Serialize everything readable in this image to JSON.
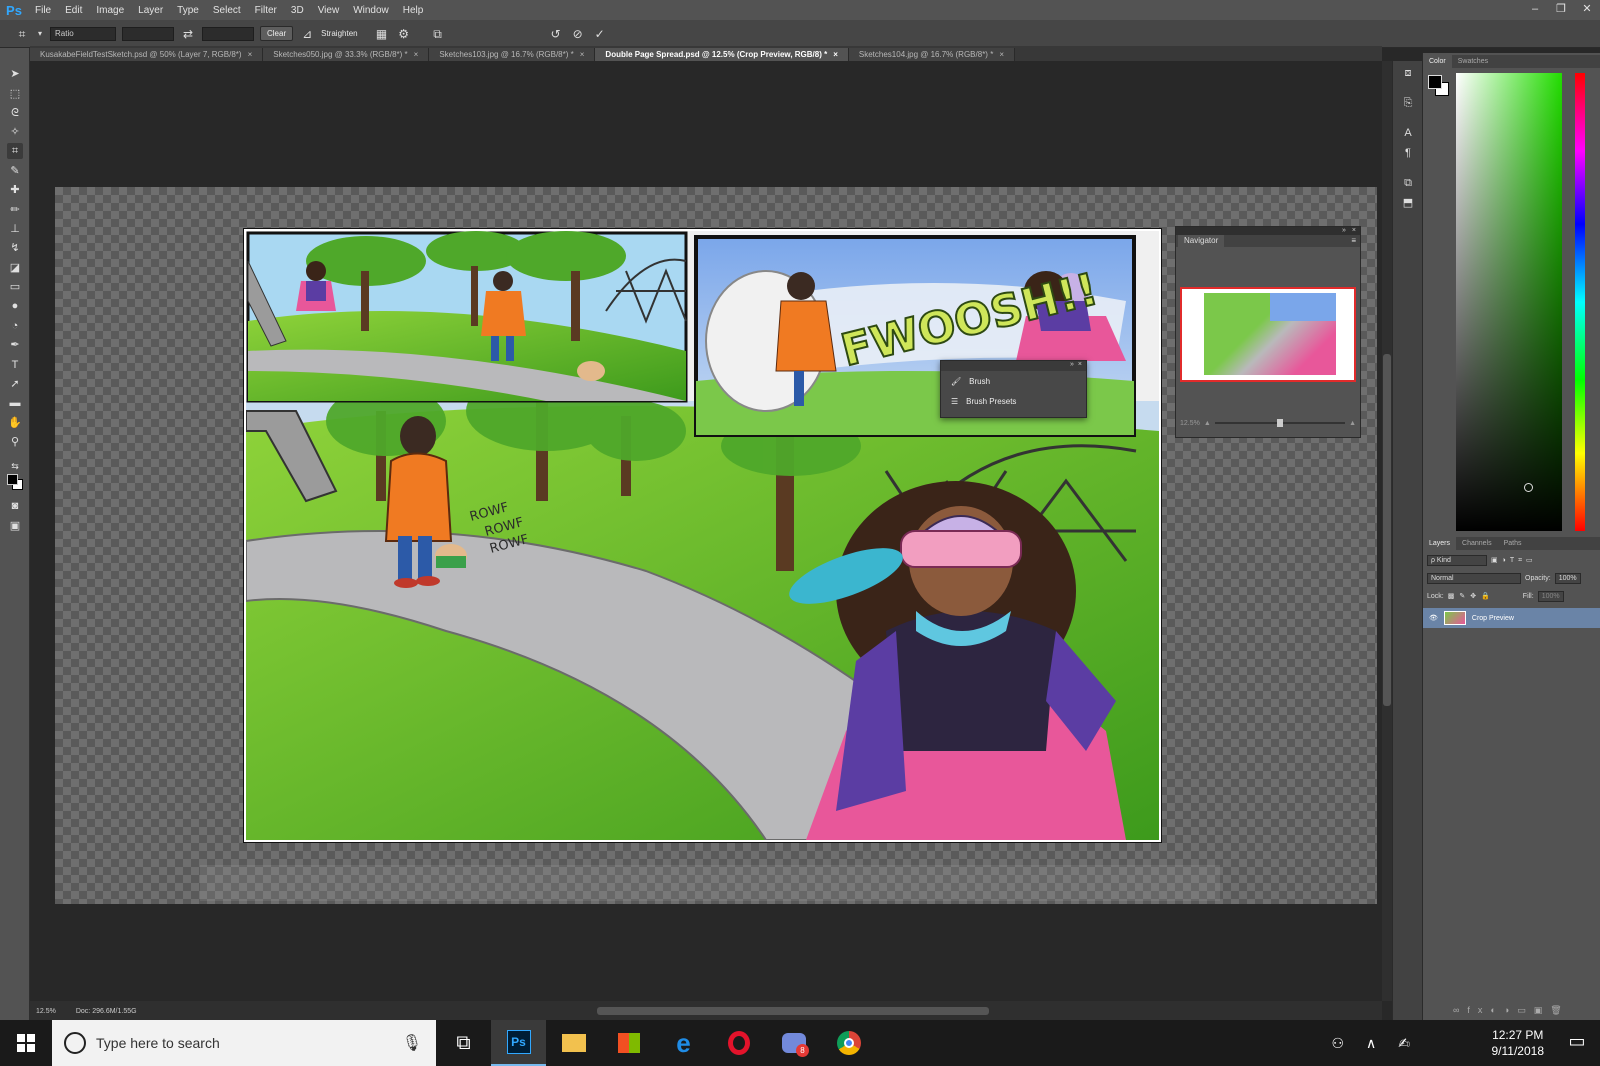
{
  "app": {
    "logo": "Ps"
  },
  "menu": [
    "File",
    "Edit",
    "Image",
    "Layer",
    "Type",
    "Select",
    "Filter",
    "3D",
    "View",
    "Window",
    "Help"
  ],
  "window_controls": [
    "–",
    "❐",
    "✕"
  ],
  "options_bar": {
    "ratio_label": "Ratio",
    "clear_label": "Clear",
    "straighten_label": "Straighten"
  },
  "tabs": [
    {
      "label": "KusakabeFieldTestSketch.psd @ 50% (Layer 7, RGB/8*)",
      "active": false
    },
    {
      "label": "Sketches050.jpg @ 33.3% (RGB/8*) *",
      "active": false
    },
    {
      "label": "Sketches103.jpg @ 16.7% (RGB/8*) *",
      "active": false
    },
    {
      "label": "Double Page Spread.psd @ 12.5% (Crop Preview, RGB/8) *",
      "active": true
    },
    {
      "label": "Sketches104.jpg @ 16.7% (RGB/8*) *",
      "active": false
    }
  ],
  "artwork": {
    "sfx_fwoosh": "FWOOSH!!",
    "sfx_rowf": [
      "ROWF",
      "ROWF",
      "ROWF"
    ]
  },
  "navigator": {
    "title": "Navigator",
    "zoom": "12.5%"
  },
  "brush_popup": {
    "items": [
      "Brush",
      "Brush Presets"
    ]
  },
  "color_panel": {
    "tabs": [
      "Color",
      "Swatches"
    ]
  },
  "layers_panel": {
    "tabs": [
      "Layers",
      "Channels",
      "Paths"
    ],
    "filter_kind": "ρ Kind",
    "blend_mode": "Normal",
    "opacity_label": "Opacity:",
    "opacity_value": "100%",
    "lock_label": "Lock:",
    "fill_label": "Fill:",
    "fill_value": "100%",
    "layer_name": "Crop Preview"
  },
  "status": {
    "zoom": "12.5%",
    "doc": "Doc: 296.6M/1.55G"
  },
  "taskbar": {
    "search_placeholder": "Type here to search",
    "time": "12:27 PM",
    "date": "9/11/2018",
    "discord_badge": "8"
  },
  "colors": {
    "accent": "#31a8ff",
    "ui_dark": "#282828",
    "ui_panel": "#535353",
    "selection": "#6a84a7"
  }
}
